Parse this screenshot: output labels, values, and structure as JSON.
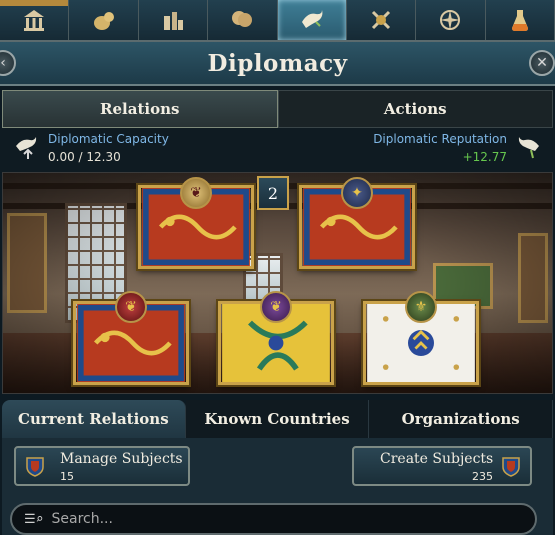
{
  "icons": {
    "tabs": [
      "government-icon",
      "economy-icon",
      "production-icon",
      "court-icon",
      "diplomacy-icon",
      "military-icon",
      "exploration-icon",
      "alchemy-icon"
    ],
    "active_tab": 4
  },
  "header": {
    "title": "Diplomacy"
  },
  "main_tabs": [
    {
      "label": "Relations",
      "active": true
    },
    {
      "label": "Actions",
      "active": false
    }
  ],
  "capacity": {
    "label": "Diplomatic Capacity",
    "value": "0.00 / 12.30"
  },
  "reputation": {
    "label": "Diplomatic Reputation",
    "value": "+12.77"
  },
  "scene": {
    "badge": "2"
  },
  "sub_tabs": [
    {
      "label": "Current Relations",
      "active": true
    },
    {
      "label": "Known Countries",
      "active": false
    },
    {
      "label": "Organizations",
      "active": false
    }
  ],
  "buttons": {
    "manage": {
      "label": "Manage Subjects",
      "count": "15"
    },
    "create": {
      "label": "Create Subjects",
      "count": "235"
    }
  },
  "search": {
    "placeholder": "Search..."
  },
  "colors": {
    "accent": "#c9a24a",
    "green": "#66c74e",
    "link": "#7fb7e6"
  }
}
